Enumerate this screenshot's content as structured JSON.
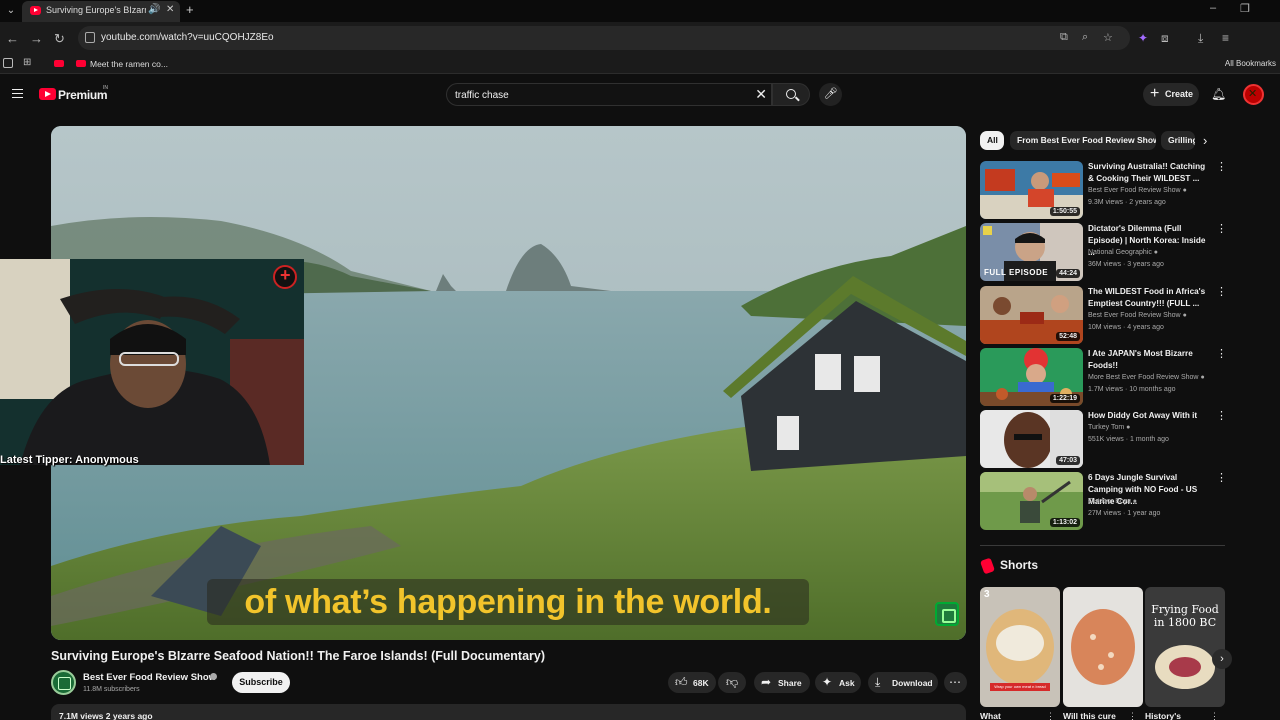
{
  "browser": {
    "tab_title": "Surviving Europe's BIzarre",
    "url": "youtube.com/watch?v=uuCQOHJZ8Eo",
    "bookmark_label": "Meet the ramen co...",
    "bookmarks_right": "All Bookmarks"
  },
  "header": {
    "brand": "Premium",
    "country": "IN",
    "search_value": "traffic chase",
    "create_label": "Create"
  },
  "video": {
    "caption": "of what’s happening in the world.",
    "latest_tipper": "Latest Tipper: Anonymous",
    "title": "Surviving Europe's BIzarre Seafood Nation!! The Faroe Islands! (Full Documentary)",
    "channel": "Best Ever Food Review Show",
    "subscribers": "11.8M subscribers",
    "subscribe_label": "Subscribe",
    "likes": "68K",
    "share_label": "Share",
    "ask_label": "Ask",
    "download_label": "Download",
    "views_date": "7.1M views  2 years ago"
  },
  "chips": [
    {
      "label": "All",
      "active": true
    },
    {
      "label": "From Best Ever Food Review Show",
      "active": false
    },
    {
      "label": "Grilling",
      "active": false
    }
  ],
  "recommendations": [
    {
      "title": "Surviving Australia!! Catching & Cooking Their WILDEST ...",
      "channel": "Best Ever Food Review Show",
      "meta": "9.3M views · 2 years ago",
      "duration": "1:50:55",
      "verified": true
    },
    {
      "title": "Dictator's Dilemma (Full Episode) | North Korea: Inside ...",
      "channel": "National Geographic",
      "meta": "36M views · 3 years ago",
      "duration": "44:24",
      "verified": true,
      "overlay": "FULL EPISODE"
    },
    {
      "title": "The WILDEST Food in Africa's Emptiest Country!!! (FULL ...",
      "channel": "Best Ever Food Review Show",
      "meta": "10M views · 4 years ago",
      "duration": "52:48",
      "verified": true
    },
    {
      "title": "I Ate JAPAN's Most Bizarre Foods!!",
      "channel": "More Best Ever Food Review Show",
      "meta": "1.7M views · 10 months ago",
      "duration": "1:22:19",
      "verified": true
    },
    {
      "title": "How Diddy Got Away With it",
      "channel": "Turkey Tom",
      "meta": "551K views · 1 month ago",
      "duration": "47:03",
      "verified": true
    },
    {
      "title": "6 Days Jungle Survival Camping with NO Food - US Marine Cor...",
      "channel": "Outdoor Boys",
      "meta": "27M views · 1 year ago",
      "duration": "1:13:02",
      "verified": true
    }
  ],
  "shorts": {
    "heading": "Shorts",
    "items": [
      {
        "caption": "What",
        "overlay_num": "3",
        "overlay_text": "Wrap your own meat n bread"
      },
      {
        "caption": "Will this cure",
        "overlay_num": "",
        "overlay_text": ""
      },
      {
        "caption": "History's",
        "overlay_num": "",
        "overlay_text": "Frying Food in 1800 BC"
      }
    ]
  },
  "colors": {
    "accent_red": "#ff0033",
    "caption_yellow": "#f2c42b",
    "background": "#0f0f0f"
  }
}
